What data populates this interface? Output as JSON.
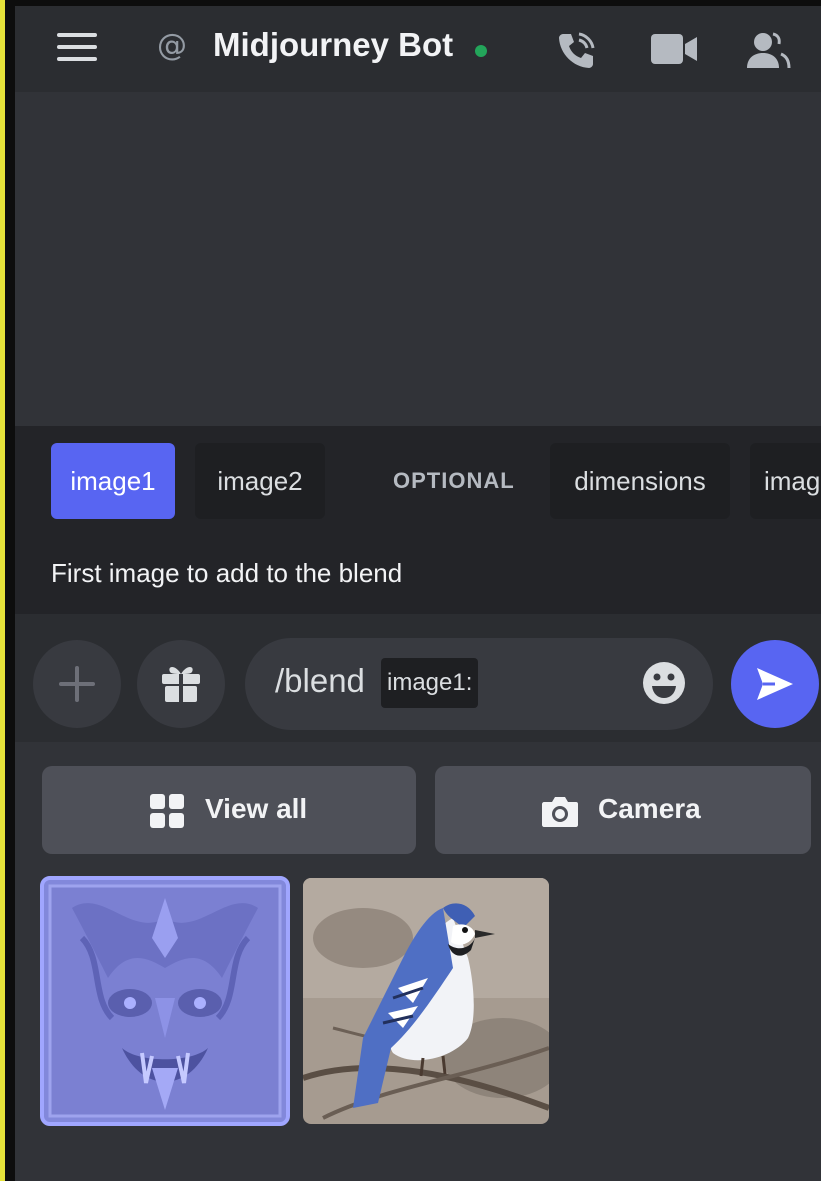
{
  "header": {
    "at_symbol": "@",
    "title": "Midjourney Bot",
    "status": "online",
    "status_color": "#23a55a",
    "icons": [
      "hamburger-icon",
      "at-icon",
      "call-icon",
      "video-icon",
      "members-icon"
    ]
  },
  "options": {
    "chips": [
      {
        "label": "image1",
        "active": true
      },
      {
        "label": "image2",
        "active": false
      },
      {
        "label": "OPTIONAL",
        "active": false
      },
      {
        "label": "dimensions",
        "active": false
      },
      {
        "label": "imag",
        "active": false
      }
    ],
    "hint": "First image to add to the blend"
  },
  "composer": {
    "command": "/blend",
    "param": "image1:",
    "icons": [
      "plus-icon",
      "gift-icon",
      "emoji-icon",
      "send-icon"
    ]
  },
  "media": {
    "view_all_label": "View all",
    "camera_label": "Camera",
    "thumbnails": [
      {
        "name": "carved-face-relief",
        "selected": true
      },
      {
        "name": "blue-jay-bird",
        "selected": false
      }
    ]
  },
  "colors": {
    "accent": "#5865f2",
    "background": "#313338",
    "header": "#2b2d31"
  }
}
